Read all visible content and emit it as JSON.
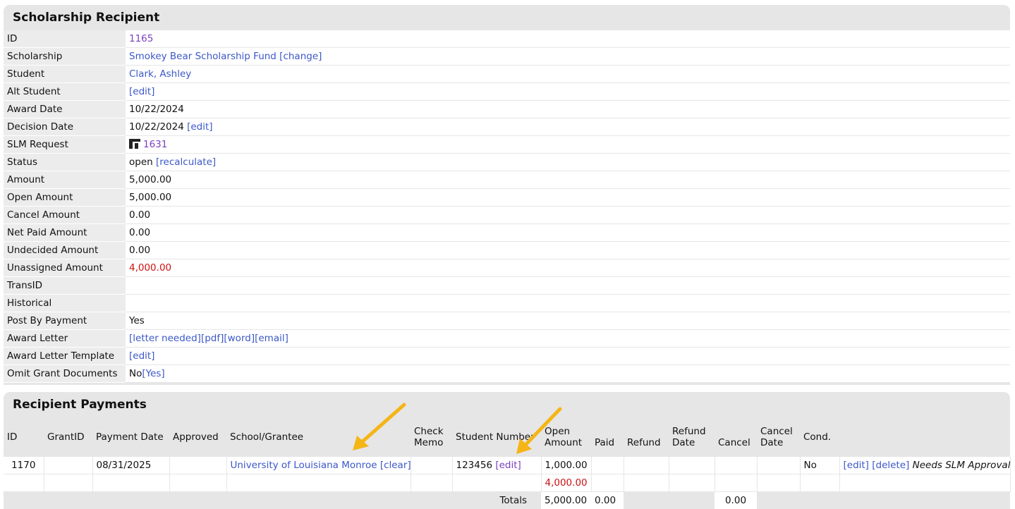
{
  "recipient": {
    "title": "Scholarship Recipient",
    "rows": {
      "id": {
        "label": "ID",
        "value": "1165"
      },
      "scholarship": {
        "label": "Scholarship",
        "value": "Smokey Bear Scholarship Fund",
        "action": "[change]"
      },
      "student": {
        "label": "Student",
        "value": "Clark, Ashley"
      },
      "alt_student": {
        "label": "Alt Student",
        "action": "[edit]"
      },
      "award_date": {
        "label": "Award Date",
        "value": "10/22/2024"
      },
      "decision_date": {
        "label": "Decision Date",
        "value": "10/22/2024",
        "action": "[edit]"
      },
      "slm_request": {
        "label": "SLM Request",
        "value": "1631",
        "icon": "slm-logo-icon"
      },
      "status": {
        "label": "Status",
        "value": "open",
        "action": "[recalculate]"
      },
      "amount": {
        "label": "Amount",
        "value": "5,000.00"
      },
      "open_amount": {
        "label": "Open Amount",
        "value": "5,000.00"
      },
      "cancel_amount": {
        "label": "Cancel Amount",
        "value": "0.00"
      },
      "net_paid_amount": {
        "label": "Net Paid Amount",
        "value": "0.00"
      },
      "undecided_amount": {
        "label": "Undecided Amount",
        "value": "0.00"
      },
      "unassigned_amount": {
        "label": "Unassigned Amount",
        "value": "4,000.00",
        "color": "#cc1111"
      },
      "trans_id": {
        "label": "TransID",
        "value": ""
      },
      "historical": {
        "label": "Historical",
        "value": ""
      },
      "post_by_payment": {
        "label": "Post By Payment",
        "value": "Yes"
      },
      "award_letter": {
        "label": "Award Letter",
        "links": [
          "[letter needed]",
          "[pdf]",
          "[word]",
          "[email]"
        ]
      },
      "award_letter_template": {
        "label": "Award Letter Template",
        "action": "[edit]"
      },
      "omit_grant_documents": {
        "label": "Omit Grant Documents",
        "value": "No",
        "action": "[Yes]"
      }
    }
  },
  "payments": {
    "title": "Recipient Payments",
    "headers": {
      "id": "ID",
      "grant_id": "GrantID",
      "payment_date": "Payment Date",
      "approved": "Approved",
      "school": "School/Grantee",
      "check_memo_1": "Check",
      "check_memo_2": "Memo",
      "student_number": "Student Number",
      "open_amount_1": "Open",
      "open_amount_2": "Amount",
      "paid": "Paid",
      "refund": "Refund",
      "refund_date_1": "Refund",
      "refund_date_2": "Date",
      "cancel": "Cancel",
      "cancel_date_1": "Cancel",
      "cancel_date_2": "Date",
      "cond": "Cond."
    },
    "row": {
      "id": "1170",
      "grant_id": "",
      "payment_date": "08/31/2025",
      "approved": "",
      "school": "University of Louisiana Monroe",
      "school_action": "[clear]",
      "check_memo": "",
      "student_number": "123456",
      "student_number_action": "[edit]",
      "open_amount": "1,000.00",
      "paid": "",
      "refund": "",
      "refund_date": "",
      "cancel": "",
      "cancel_date": "",
      "cond": "No",
      "edit": "[edit]",
      "delete": "[delete]",
      "note": "Needs SLM Approval"
    },
    "unassigned_row": {
      "open_amount": "4,000.00"
    },
    "totals": {
      "label": "Totals",
      "open_amount": "5,000.00",
      "paid": "0.00",
      "cancel": "0.00"
    }
  },
  "colors": {
    "link": "#3c58c8",
    "visited_link": "#7b3fbf",
    "alert": "#cc1111",
    "arrow": "#f5b516",
    "panel": "#e6e6e6"
  }
}
